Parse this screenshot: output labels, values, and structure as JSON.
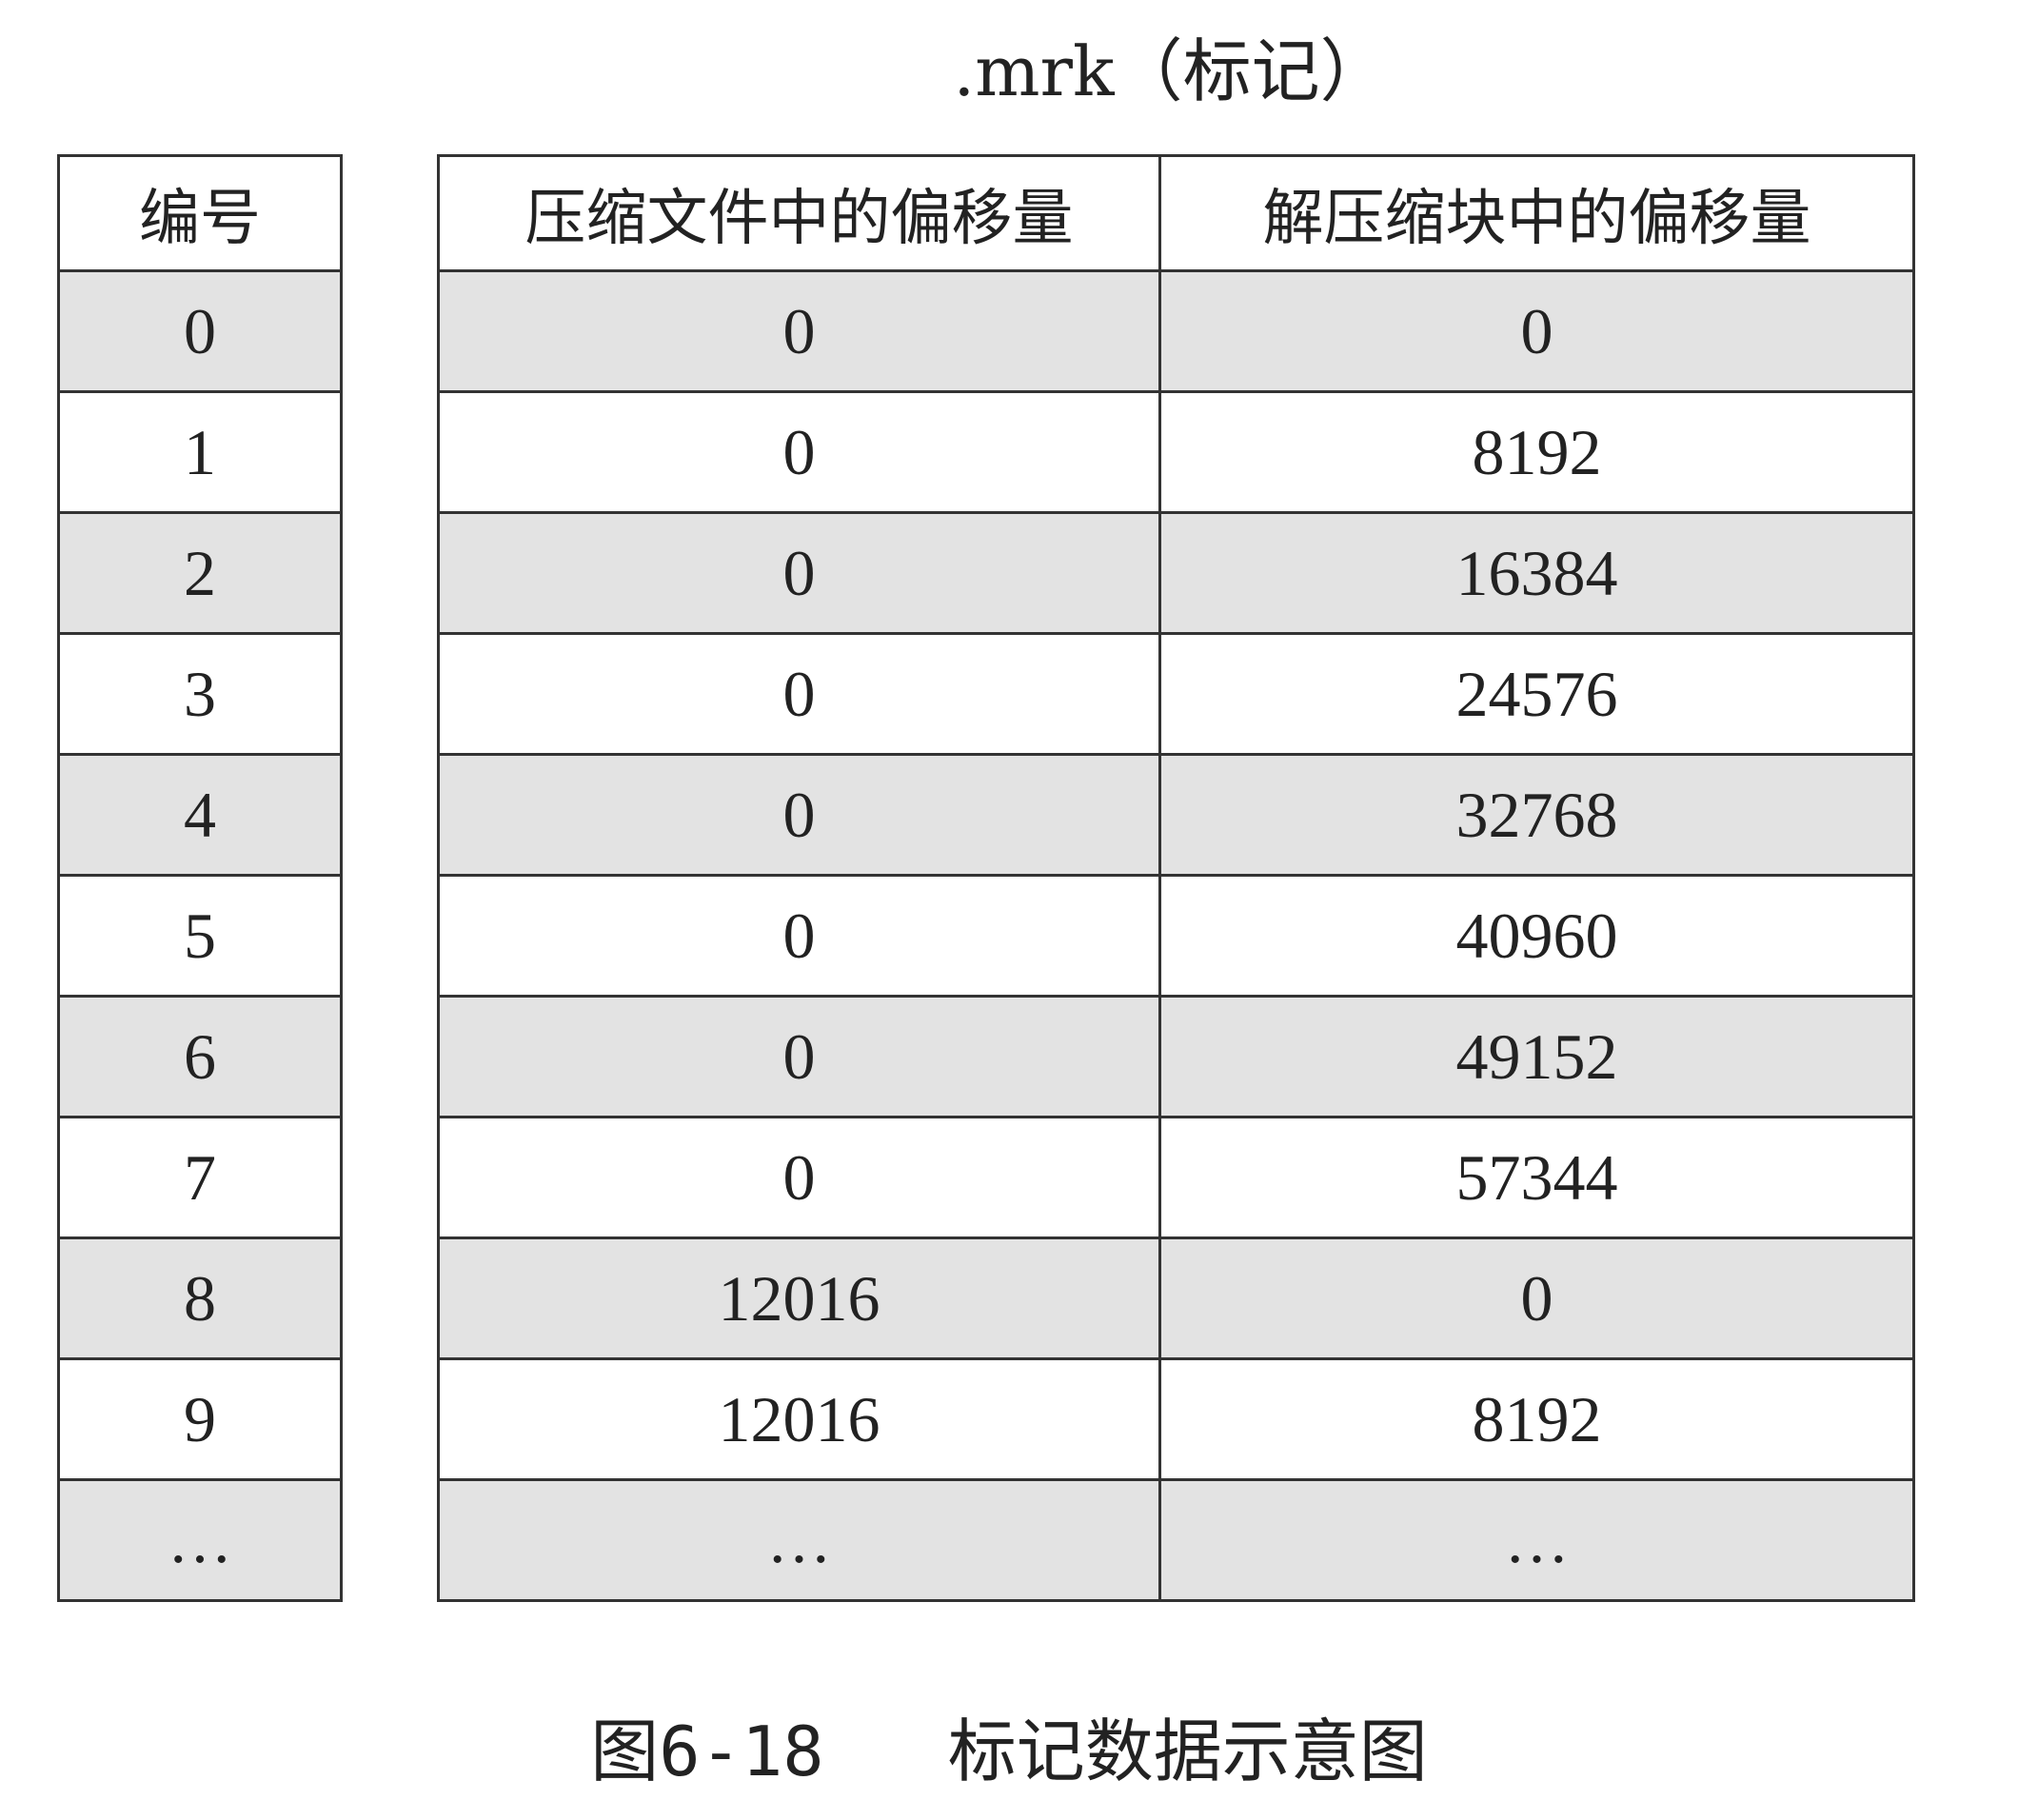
{
  "title": ".mrk（标记）",
  "index_header": "编号",
  "mrk_headers": [
    "压缩文件中的偏移量",
    "解压缩块中的偏移量"
  ],
  "rows": [
    {
      "id": "0",
      "compressed_offset": "0",
      "decompressed_offset": "0"
    },
    {
      "id": "1",
      "compressed_offset": "0",
      "decompressed_offset": "8192"
    },
    {
      "id": "2",
      "compressed_offset": "0",
      "decompressed_offset": "16384"
    },
    {
      "id": "3",
      "compressed_offset": "0",
      "decompressed_offset": "24576"
    },
    {
      "id": "4",
      "compressed_offset": "0",
      "decompressed_offset": "32768"
    },
    {
      "id": "5",
      "compressed_offset": "0",
      "decompressed_offset": "40960"
    },
    {
      "id": "6",
      "compressed_offset": "0",
      "decompressed_offset": "49152"
    },
    {
      "id": "7",
      "compressed_offset": "0",
      "decompressed_offset": "57344"
    },
    {
      "id": "8",
      "compressed_offset": "12016",
      "decompressed_offset": "0"
    },
    {
      "id": "9",
      "compressed_offset": "12016",
      "decompressed_offset": "8192"
    },
    {
      "id": "…",
      "compressed_offset": "…",
      "decompressed_offset": "…"
    }
  ],
  "caption": {
    "number": "图6-18",
    "text": "标记数据示意图"
  },
  "colors": {
    "shaded_row": "#e3e3e3",
    "plain_row": "#ffffff",
    "border": "#333333"
  }
}
